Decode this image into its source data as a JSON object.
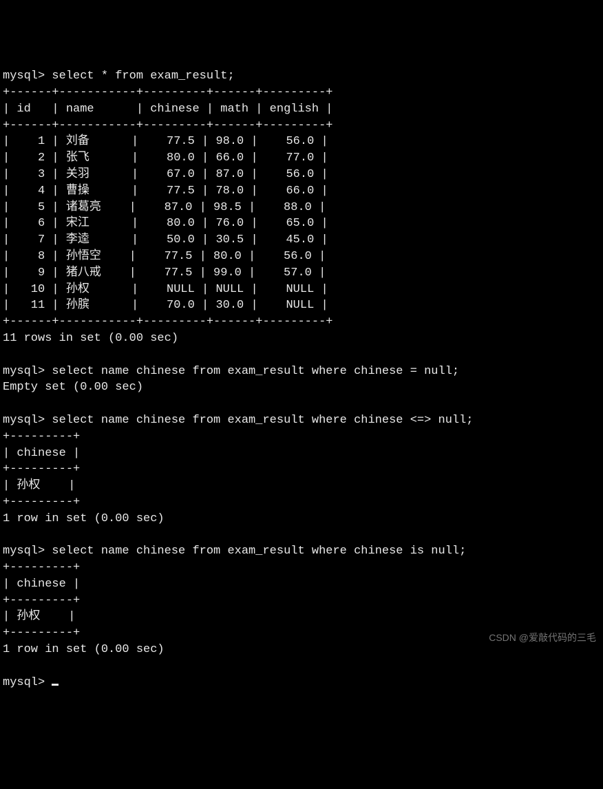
{
  "prompt": "mysql>",
  "queries": {
    "q1": "select * from exam_result;",
    "q2": "select name chinese from exam_result where chinese = null;",
    "q3": "select name chinese from exam_result where chinese <=> null;",
    "q4": "select name chinese from exam_result where chinese is null;"
  },
  "table1": {
    "headers": [
      "id",
      "name",
      "chinese",
      "math",
      "english"
    ],
    "rows": [
      {
        "id": "1",
        "name": "刘备",
        "chinese": "77.5",
        "math": "98.0",
        "english": "56.0"
      },
      {
        "id": "2",
        "name": "张飞",
        "chinese": "80.0",
        "math": "66.0",
        "english": "77.0"
      },
      {
        "id": "3",
        "name": "关羽",
        "chinese": "67.0",
        "math": "87.0",
        "english": "56.0"
      },
      {
        "id": "4",
        "name": "曹操",
        "chinese": "77.5",
        "math": "78.0",
        "english": "66.0"
      },
      {
        "id": "5",
        "name": "诸葛亮",
        "chinese": "87.0",
        "math": "98.5",
        "english": "88.0"
      },
      {
        "id": "6",
        "name": "宋江",
        "chinese": "80.0",
        "math": "76.0",
        "english": "65.0"
      },
      {
        "id": "7",
        "name": "李逵",
        "chinese": "50.0",
        "math": "30.5",
        "english": "45.0"
      },
      {
        "id": "8",
        "name": "孙悟空",
        "chinese": "77.5",
        "math": "80.0",
        "english": "56.0"
      },
      {
        "id": "9",
        "name": "猪八戒",
        "chinese": "77.5",
        "math": "99.0",
        "english": "57.0"
      },
      {
        "id": "10",
        "name": "孙权",
        "chinese": "NULL",
        "math": "NULL",
        "english": "NULL"
      },
      {
        "id": "11",
        "name": "孙膑",
        "chinese": "70.0",
        "math": "30.0",
        "english": "NULL"
      }
    ],
    "footer": "11 rows in set (0.00 sec)"
  },
  "result2": "Empty set (0.00 sec)",
  "table3": {
    "header": "chinese",
    "row": "孙权",
    "footer": "1 row in set (0.00 sec)"
  },
  "table4": {
    "header": "chinese",
    "row": "孙权",
    "footer": "1 row in set (0.00 sec)"
  },
  "watermark": "CSDN @爱敲代码的三毛",
  "sep": {
    "t1_border": "+------+-----------+---------+------+---------+",
    "t1_header": "| id   | name      | chinese | math | english |",
    "small_border": "+---------+",
    "small_header": "| chinese |"
  }
}
